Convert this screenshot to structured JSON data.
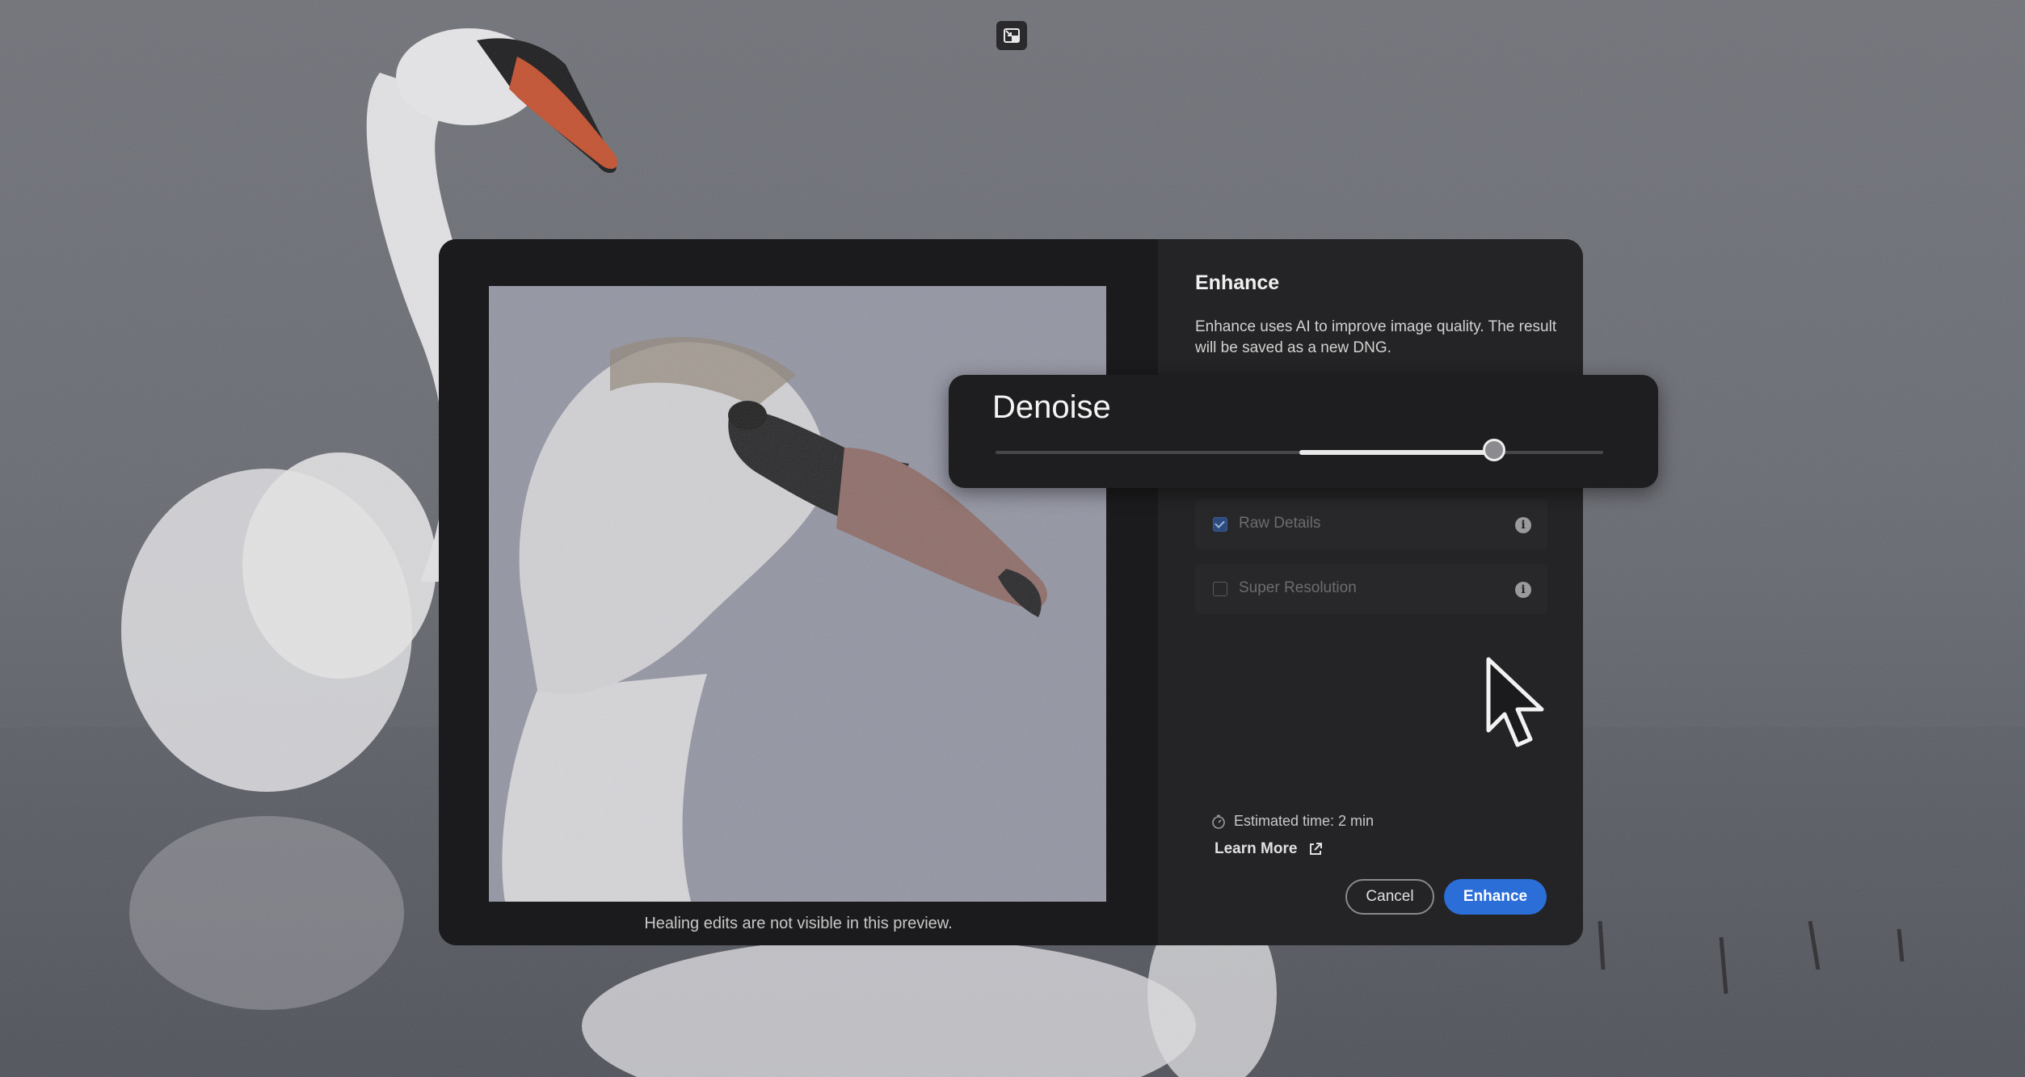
{
  "dialog": {
    "title": "Enhance",
    "description": "Enhance uses AI to improve image quality. The result will be saved as a new DNG.",
    "preview_caption": "Healing edits are not visible in this preview.",
    "options": [
      {
        "label": "Raw Details",
        "checked": true
      },
      {
        "label": "Super Resolution",
        "checked": false
      }
    ],
    "estimated_time": "Estimated time: 2 min",
    "learn_more": "Learn More",
    "cancel_label": "Cancel",
    "enhance_label": "Enhance"
  },
  "denoise": {
    "label": "Denoise",
    "range_start": 0.5,
    "value": 0.82
  },
  "icons": {
    "restore": "exit-fullscreen-icon",
    "info": "info-icon",
    "timer": "timer-icon",
    "external": "external-link-icon",
    "cursor": "mouse-pointer-icon"
  },
  "colors": {
    "accent": "#2c6ed8",
    "dialog_bg": "#1d1d1f",
    "side_bg": "#242426"
  }
}
